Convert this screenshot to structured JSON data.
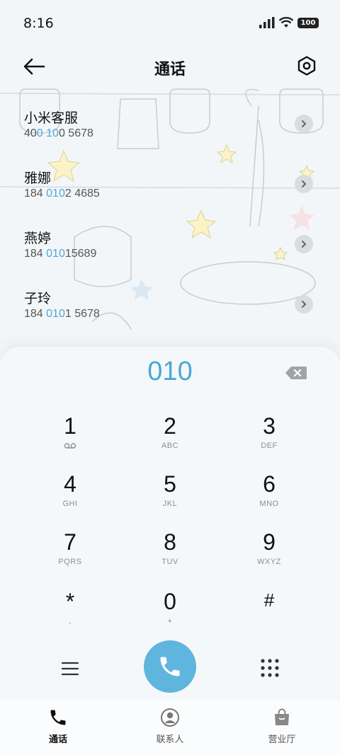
{
  "status_bar": {
    "time": "8:16",
    "battery": "100"
  },
  "header": {
    "title": "通话"
  },
  "contacts": [
    {
      "name": "小米客服",
      "number_parts": [
        "40",
        "0",
        " ",
        "10",
        "0 5678"
      ]
    },
    {
      "name": "雅娜",
      "number_parts": [
        "184 ",
        "010",
        "2 4685"
      ]
    },
    {
      "name": "燕婷",
      "number_parts": [
        "184 ",
        "010",
        "15689"
      ]
    },
    {
      "name": "子玲",
      "number_parts": [
        "184 ",
        "010",
        "1 5678"
      ]
    }
  ],
  "dialpad": {
    "input": "010",
    "keys": [
      {
        "digit": "1",
        "letters": ""
      },
      {
        "digit": "2",
        "letters": "ABC"
      },
      {
        "digit": "3",
        "letters": "DEF"
      },
      {
        "digit": "4",
        "letters": "GHI"
      },
      {
        "digit": "5",
        "letters": "JKL"
      },
      {
        "digit": "6",
        "letters": "MNO"
      },
      {
        "digit": "7",
        "letters": "PQRS"
      },
      {
        "digit": "8",
        "letters": "TUV"
      },
      {
        "digit": "9",
        "letters": "WXYZ"
      },
      {
        "digit": "*",
        "letters": ","
      },
      {
        "digit": "0",
        "letters": "+"
      },
      {
        "digit": "#",
        "letters": ""
      }
    ]
  },
  "bottom_nav": [
    {
      "label": "通话",
      "icon": "phone-icon",
      "active": true
    },
    {
      "label": "联系人",
      "icon": "person-icon",
      "active": false
    },
    {
      "label": "营业厅",
      "icon": "bag-icon",
      "active": false
    }
  ],
  "colors": {
    "accent": "#4aa8d6",
    "call_button": "#5fb5dd"
  }
}
